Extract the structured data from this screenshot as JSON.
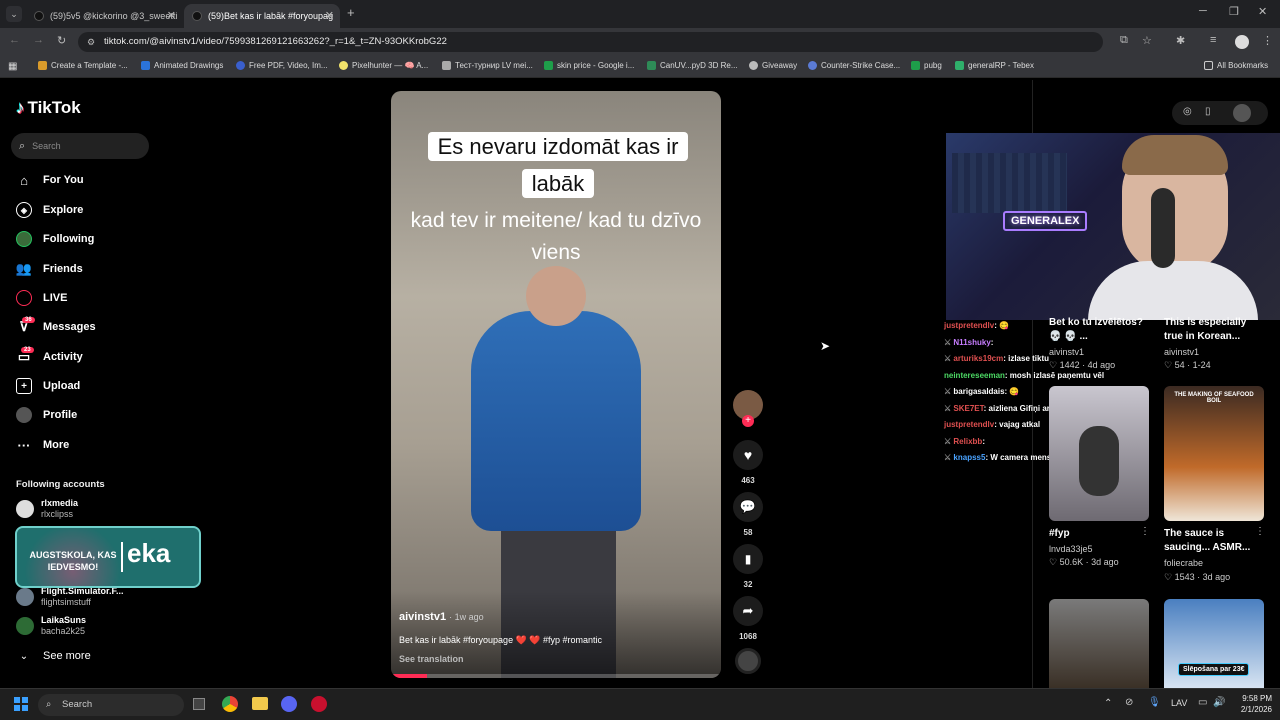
{
  "browser": {
    "tabs": [
      {
        "title": "(59)5v5 @kickorino @3_sweetti"
      },
      {
        "title": "(59)Bet kas ir labāk #foryoupag"
      }
    ],
    "url": "tiktok.com/@aivinstv1/video/7599381269121663262?_r=1&_t=ZN-93OKKrobG22",
    "bookmarks": [
      "Create a Template -...",
      "Animated Drawings",
      "Free PDF, Video, Im...",
      "Pixelhunter — 🧠 A...",
      "Тест-турнир LV mei...",
      "skin price - Google i...",
      "CanUV...pyD 3D Re...",
      "Giveaway",
      "Counter-Strike Case...",
      "pubg",
      "generalRP - Tebex"
    ],
    "all_bookmarks": "All Bookmarks"
  },
  "tiktok": {
    "logo": "TikTok",
    "search_placeholder": "Search",
    "nav": [
      {
        "label": "For You",
        "icon": "home-icon"
      },
      {
        "label": "Explore",
        "icon": "compass-icon"
      },
      {
        "label": "Following",
        "icon": "following-avatar-icon"
      },
      {
        "label": "Friends",
        "icon": "friends-icon"
      },
      {
        "label": "LIVE",
        "icon": "live-icon"
      },
      {
        "label": "Messages",
        "icon": "messages-icon",
        "badge": "36"
      },
      {
        "label": "Activity",
        "icon": "activity-icon",
        "badge": "23"
      },
      {
        "label": "Upload",
        "icon": "upload-icon"
      },
      {
        "label": "Profile",
        "icon": "profile-icon"
      },
      {
        "label": "More",
        "icon": "more-icon"
      }
    ],
    "following_title": "Following accounts",
    "accounts": [
      {
        "name": "rlxmedia",
        "handle": "rlxclipss"
      },
      {
        "name": "Flight.Simulator.F...",
        "handle": "flightsimstuff"
      },
      {
        "name": "LaikaSuns",
        "handle": "bacha2k25"
      }
    ],
    "see_more": "See more",
    "overlay_banner": {
      "text": "AUGSTSKOLA, KAS IEDVESMO!",
      "suffix": "eka"
    },
    "video": {
      "caption_top": "Es nevaru izdomāt kas ir labāk",
      "caption_mid": "kad tev ir meitene/ kad tu dzīvo viens",
      "author": "aivinstv1",
      "age": "· 1w ago",
      "description": "Bet kas ir labāk #foryoupage ❤️ ❤️ #fyp #romantic",
      "see_translation": "See translation",
      "progress": 0.11
    },
    "actions": {
      "likes": "463",
      "comments": "58",
      "saves": "32",
      "shares": "1068"
    }
  },
  "stream": {
    "chat": [
      {
        "user": "justpretendlv",
        "msg": ": 😋",
        "color": "#e05050"
      },
      {
        "user": "N11shuky",
        "msg": ":",
        "color": "#c77dff"
      },
      {
        "user": "arturiks19cm",
        "msg": ": izlase tiktu",
        "color": "#e05050"
      },
      {
        "user": "neintereseeman",
        "msg": ": mosh izlasē paņemtu vēl",
        "color": "#4cd964"
      },
      {
        "user": "barigasaldais",
        "msg": ": 😋",
        "color": "#ffffff"
      },
      {
        "user": "SKE7ET",
        "msg": ": aizliena Gifiņi ar",
        "color": "#e05050"
      },
      {
        "user": "justpretendlv",
        "msg": ": vajag atkal",
        "color": "#e05050"
      },
      {
        "user": "Relixbb",
        "msg": ":",
        "color": "#e05050"
      },
      {
        "user": "knapss5",
        "msg": ": W camera mens",
        "color": "#4aa3ff"
      }
    ],
    "webcam_sign": "GENERALEX",
    "cards": [
      {
        "title": "Bet ko tu izvēlētos? 💀 💀 ...",
        "author": "aivinstv1",
        "likes": "♡ 1442",
        "age": "· 4d ago"
      },
      {
        "title": "This is especially true in Korean...",
        "author": "aivinstv1",
        "likes": "♡ 54",
        "age": "· 1-24"
      },
      {
        "title": "#fyp",
        "author": "lnvda33je5",
        "likes": "♡ 50.6K",
        "age": "· 3d ago"
      },
      {
        "title": "The sauce is saucing... ASMR...",
        "author": "foliecrabe",
        "likes": "♡ 1543",
        "age": "· 3d ago"
      }
    ],
    "seafood_text": "THE MAKING OF SEAFOOD BOIL",
    "promo": "Slēpošana par 23€"
  },
  "taskbar": {
    "search": "Search",
    "lang": "LAV",
    "time": "9:58 PM",
    "date": "2/1/2026"
  }
}
